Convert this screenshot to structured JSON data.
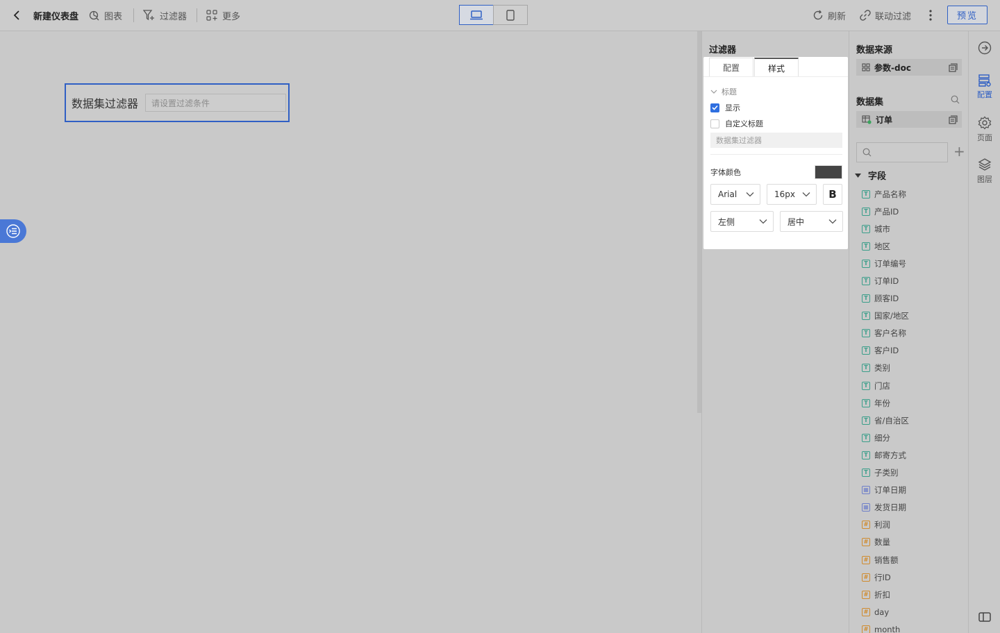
{
  "topbar": {
    "title": "新建仪表盘",
    "chart_label": "图表",
    "filter_label": "过滤器",
    "more_label": "更多",
    "refresh_label": "刷新",
    "link_filter_label": "联动过滤",
    "preview_label": "预览"
  },
  "canvas": {
    "widget_title": "数据集过滤器",
    "widget_placeholder": "请设置过滤条件"
  },
  "filter_panel": {
    "title": "过滤器",
    "tabs": [
      {
        "label": "配置"
      },
      {
        "label": "样式"
      }
    ],
    "active_tab": "样式",
    "section_title": "标题",
    "show_label": "显示",
    "show_checked": true,
    "custom_title_label": "自定义标题",
    "custom_title_checked": false,
    "title_input_placeholder": "数据集过滤器",
    "font_color_label": "字体颜色",
    "font_color": "#444444",
    "font_family": "Arial",
    "font_size": "16px",
    "bold_label": "B",
    "align_label": "左侧",
    "position_label": "居中"
  },
  "data_panel": {
    "source_heading": "数据来源",
    "source_name": "参数-doc",
    "dataset_heading": "数据集",
    "dataset_name": "订单",
    "fields_heading": "字段",
    "fields": [
      {
        "name": "产品名称",
        "type": "T"
      },
      {
        "name": "产品ID",
        "type": "T"
      },
      {
        "name": "城市",
        "type": "T"
      },
      {
        "name": "地区",
        "type": "T"
      },
      {
        "name": "订单编号",
        "type": "T"
      },
      {
        "name": "订单ID",
        "type": "T"
      },
      {
        "name": "顾客ID",
        "type": "T"
      },
      {
        "name": "国家/地区",
        "type": "T"
      },
      {
        "name": "客户名称",
        "type": "T"
      },
      {
        "name": "客户ID",
        "type": "T"
      },
      {
        "name": "类别",
        "type": "T"
      },
      {
        "name": "门店",
        "type": "T"
      },
      {
        "name": "年份",
        "type": "T"
      },
      {
        "name": "省/自治区",
        "type": "T"
      },
      {
        "name": "细分",
        "type": "T"
      },
      {
        "name": "邮寄方式",
        "type": "T"
      },
      {
        "name": "子类别",
        "type": "T"
      },
      {
        "name": "订单日期",
        "type": "D"
      },
      {
        "name": "发货日期",
        "type": "D"
      },
      {
        "name": "利润",
        "type": "N"
      },
      {
        "name": "数量",
        "type": "N"
      },
      {
        "name": "销售额",
        "type": "N"
      },
      {
        "name": "行ID",
        "type": "N"
      },
      {
        "name": "折扣",
        "type": "N"
      },
      {
        "name": "day",
        "type": "N"
      },
      {
        "name": "month",
        "type": "N"
      }
    ]
  },
  "rail": {
    "config_label": "配置",
    "page_label": "页面",
    "layer_label": "图层"
  }
}
